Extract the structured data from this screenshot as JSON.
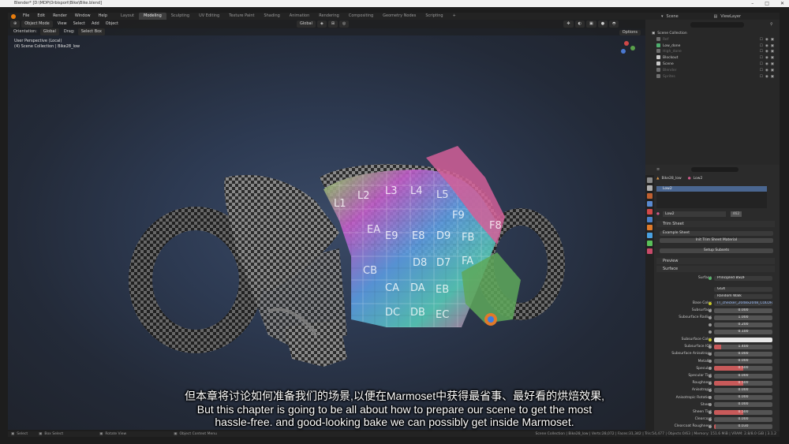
{
  "window": {
    "title": "Blender* [D:\\MDP\\Orbisport\\Bike\\Bike.blend]",
    "controls": [
      "–",
      "□",
      "✕"
    ]
  },
  "menubar": {
    "items": [
      "File",
      "Edit",
      "Render",
      "Window",
      "Help"
    ],
    "workspaces": [
      "Layout",
      "Modeling",
      "Sculpting",
      "UV Editing",
      "Texture Paint",
      "Shading",
      "Animation",
      "Rendering",
      "Compositing",
      "Geometry Nodes",
      "Scripting"
    ],
    "active_workspace": "Modeling",
    "scene": "Scene",
    "view_layer": "ViewLayer"
  },
  "viewport": {
    "mode": "Object Mode",
    "menus": [
      "View",
      "Select",
      "Add",
      "Object"
    ],
    "orientation_label": "Orientation:",
    "orientation_value": "Global",
    "drag_label": "Drag:",
    "drag_value": "Select Box",
    "transform_global": "Global",
    "options": "Options",
    "info_line1": "User Perspective (Local)",
    "info_line2": "(4) Scene Collection | Bike28_low",
    "uv_labels": [
      "L1",
      "L2",
      "L3",
      "L4",
      "L5",
      "F9",
      "F8",
      "EA",
      "E9",
      "E8",
      "D9",
      "D8",
      "D7",
      "CB",
      "CA",
      "DA",
      "DB",
      "DC",
      "EB",
      "EC",
      "FA",
      "FB"
    ]
  },
  "subtitles": {
    "zh": "但本章将讨论如何准备我们的场景,以便在Marmoset中获得最省事、最好看的烘焙效果,",
    "en1": "But this chapter is going to be all about how to prepare our scene to get the most",
    "en2": "hassle-free. and good-looking bake we can possibly get inside Marmoset."
  },
  "statusbar": {
    "select": "Select",
    "box_select": "Box Select",
    "rotate_view": "Rotate View",
    "context_menu": "Object Context Menu",
    "stats": "Scene Collection | Bike28_low | Verts:28,072 | Faces:31,342 | Tris:54,477 | Objects:0/63 | Memory: 151.6 MiB | VRAM: 2.8/8.0 GiB | 3.1.2"
  },
  "outliner": {
    "root": "Scene Collection",
    "items": [
      {
        "label": "Ref",
        "dim": true,
        "color": "#6e6e6e"
      },
      {
        "label": "Low_done",
        "dim": false,
        "color": "#4fb06f"
      },
      {
        "label": "High_done",
        "dim": true,
        "color": "#6e6e6e"
      },
      {
        "label": "Blockout",
        "dim": false,
        "color": "#c9c9c9"
      },
      {
        "label": "Scene",
        "dim": false,
        "color": "#c9c9c9"
      },
      {
        "label": "Blender",
        "dim": true,
        "color": "#6e6e6e"
      },
      {
        "label": "Sprites",
        "dim": true,
        "color": "#6e6e6e"
      }
    ]
  },
  "properties": {
    "object": "Bike28_low",
    "material_slot": "Low2",
    "slot_item": "Low2",
    "material_name": "Low2",
    "users": "462",
    "trim_sheet_header": "Trim Sheet",
    "trim_example": "Example Sheet",
    "trim_btn1": "Init Trim Sheet Material",
    "trim_btn2": "Setup Subsets",
    "preview_header": "Preview",
    "surface_header": "Surface",
    "surface_label": "Surface",
    "surface_value": "Principled BSDF",
    "distribution": "GGX",
    "subsurface_method": "Random Walk",
    "rows": [
      {
        "label": "Base Color",
        "value": "TT_checker_2048x2048_COLOR_GRID",
        "kind": "texture",
        "fill": 0
      },
      {
        "label": "Subsurface",
        "value": "0.000",
        "kind": "num",
        "fill": 0
      },
      {
        "label": "Subsurface Radius",
        "value": "1.000",
        "kind": "num",
        "fill": 0
      },
      {
        "label": "",
        "value": "0.200",
        "kind": "num",
        "fill": 0
      },
      {
        "label": "",
        "value": "0.100",
        "kind": "num",
        "fill": 0
      },
      {
        "label": "Subsurface Color",
        "value": "",
        "kind": "color",
        "fill": 0
      },
      {
        "label": "Subsurface IOR",
        "value": "1.400",
        "kind": "num",
        "fill": 0.12
      },
      {
        "label": "Subsurface Anisotropy",
        "value": "0.000",
        "kind": "num",
        "fill": 0
      },
      {
        "label": "Metallic",
        "value": "0.000",
        "kind": "num",
        "fill": 0
      },
      {
        "label": "Specular",
        "value": "0.500",
        "kind": "num",
        "fill": 0.5
      },
      {
        "label": "Specular Tint",
        "value": "0.000",
        "kind": "num",
        "fill": 0
      },
      {
        "label": "Roughness",
        "value": "0.500",
        "kind": "num",
        "fill": 0.5
      },
      {
        "label": "Anisotropic",
        "value": "0.000",
        "kind": "num",
        "fill": 0
      },
      {
        "label": "Anisotropic Rotation",
        "value": "0.000",
        "kind": "num",
        "fill": 0
      },
      {
        "label": "Sheen",
        "value": "0.000",
        "kind": "num",
        "fill": 0
      },
      {
        "label": "Sheen Tint",
        "value": "0.500",
        "kind": "num",
        "fill": 0.5
      },
      {
        "label": "Clearcoat",
        "value": "0.000",
        "kind": "num",
        "fill": 0
      },
      {
        "label": "Clearcoat Roughness",
        "value": "0.030",
        "kind": "num",
        "fill": 0.03
      }
    ]
  }
}
